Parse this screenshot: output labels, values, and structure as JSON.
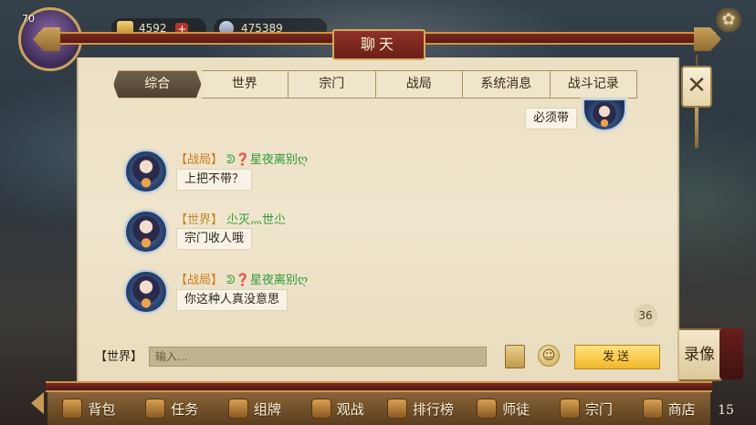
{
  "hud": {
    "level": "70",
    "coins": "4592",
    "diamonds": "475389",
    "plus_symbol": "+",
    "gear_glyph": "✿",
    "replay_label": "录像",
    "corner_count": "15"
  },
  "panel": {
    "title": "聊天",
    "close_glyph": "✕"
  },
  "tabs": [
    "综合",
    "世界",
    "宗门",
    "战局",
    "系统消息",
    "战斗记录"
  ],
  "active_tab_index": 0,
  "messages": [
    {
      "own": true,
      "text": "必须带"
    },
    {
      "own": false,
      "channel": "【战局】",
      "sender": "ᕲ❓星夜离别ღ",
      "text": "上把不带？"
    },
    {
      "own": false,
      "channel": "【世界】",
      "sender": "尐灭灬世尐",
      "text": "宗门收人哦"
    },
    {
      "own": false,
      "channel": "【战局】",
      "sender": "ᕲ❓星夜离别ღ",
      "text": "你这种人真没意思"
    }
  ],
  "unread_count": "36",
  "input": {
    "channel_label": "【世界】",
    "placeholder": "输入...",
    "value": "",
    "emoji_glyph": "☺",
    "send_label": "发送"
  },
  "bottom_nav": [
    "背包",
    "任务",
    "组牌",
    "观战",
    "排行榜",
    "师徒",
    "宗门",
    "商店"
  ],
  "colors": {
    "frame_red": "#7c2a1f",
    "gold_trim": "#c8964a",
    "paper": "#ece0c4",
    "channel_orange": "#d17a1a",
    "sender_green": "#2f9a3a",
    "send_yellow": "#f1b82a"
  }
}
